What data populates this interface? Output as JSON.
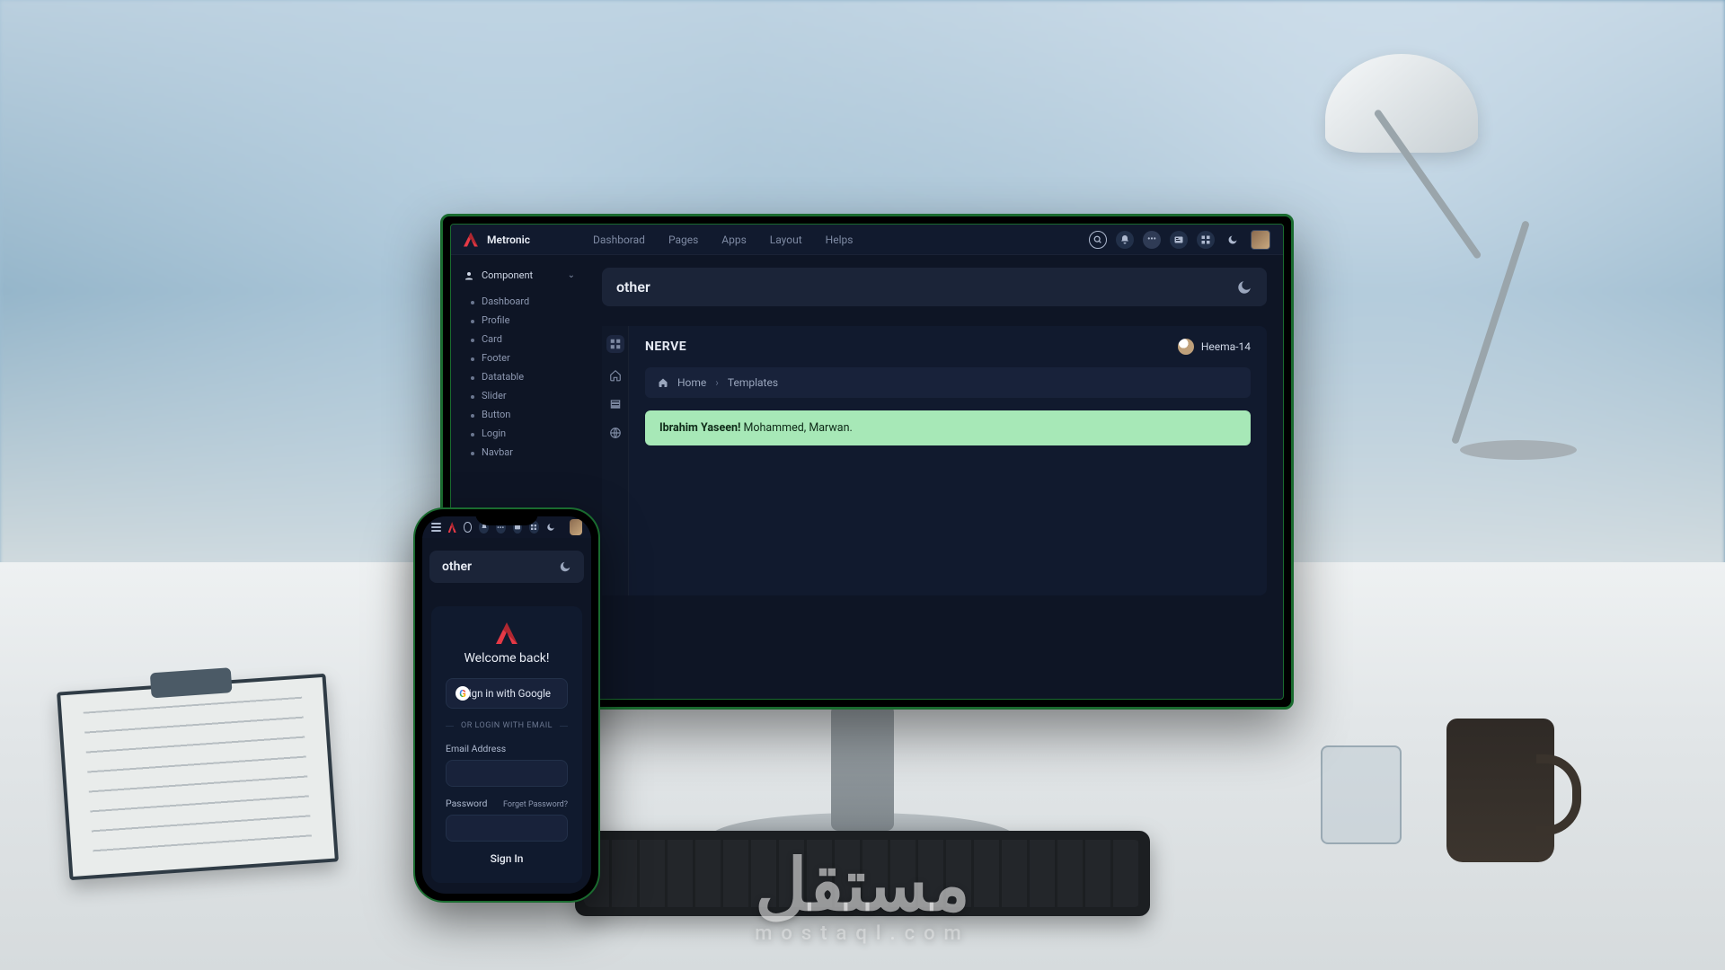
{
  "watermark": {
    "main": "مستقل",
    "sub": "mostaql.com"
  },
  "desktop": {
    "brand": "Metronic",
    "nav": {
      "dashboard": "Dashborad",
      "pages": "Pages",
      "apps": "Apps",
      "layout": "Layout",
      "helps": "Helps"
    },
    "msg_badge": "•••",
    "sidebar": {
      "heading": "Component",
      "items": [
        "Dashboard",
        "Profile",
        "Card",
        "Footer",
        "Datatable",
        "Slider",
        "Button",
        "Login",
        "Navbar"
      ]
    },
    "titlebar": {
      "title": "other"
    },
    "panel": {
      "brand": "NERVE",
      "user": "Heema-14",
      "crumbs": {
        "home": "Home",
        "current": "Templates"
      },
      "alert_bold": "Ibrahim Yaseen!",
      "alert_rest": " Mohammed, Marwan."
    }
  },
  "mobile": {
    "titlebar": {
      "title": "other"
    },
    "welcome": "Welcome back!",
    "google_btn": "Sign in with Google",
    "or_text": "OR LOGIN WITH EMAIL",
    "email_label": "Email Address",
    "password_label": "Password",
    "forgot": "Forget Password?",
    "signin": "Sign In"
  }
}
